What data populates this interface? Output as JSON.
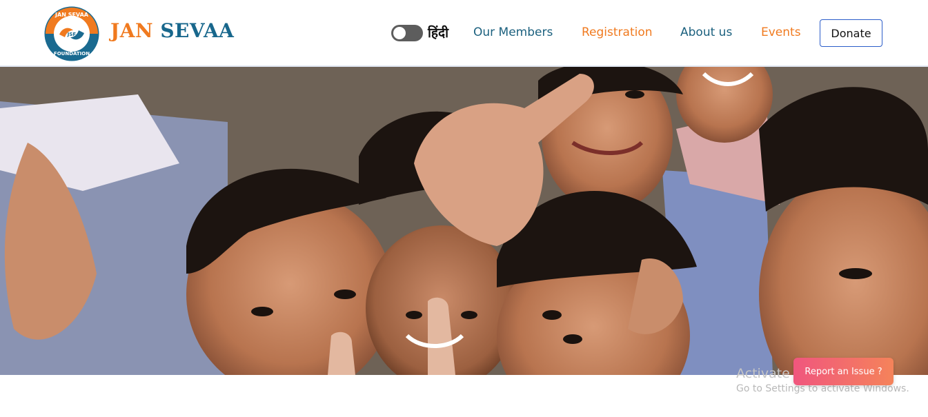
{
  "header": {
    "logo_text_top": "JAN SEVAA",
    "logo_text_center": "JSF",
    "logo_text_bottom": "FOUNDATION",
    "brand_word1": "JAN",
    "brand_word2": "SEVAA",
    "language_toggle_label": "हिंदी",
    "language_toggle_on": false,
    "nav": [
      {
        "label": "Our Members",
        "color": "#1b607e"
      },
      {
        "label": "Registration",
        "color": "#f07a1f"
      },
      {
        "label": "About us",
        "color": "#1b607e"
      },
      {
        "label": "Events",
        "color": "#f07a1f"
      }
    ],
    "donate_label": "Donate"
  },
  "hero": {
    "image_subject": "group of smiling children making peace signs"
  },
  "watermark": {
    "line1": "Activate Windows",
    "line2": "Go to Settings to activate Windows."
  },
  "report_button_label": "Report an Issue ?",
  "colors": {
    "brand_orange": "#f07a1f",
    "brand_blue": "#18678c",
    "donate_border": "#2a5cc9",
    "report_gradient_start": "#f0567e",
    "report_gradient_end": "#f5835a"
  }
}
